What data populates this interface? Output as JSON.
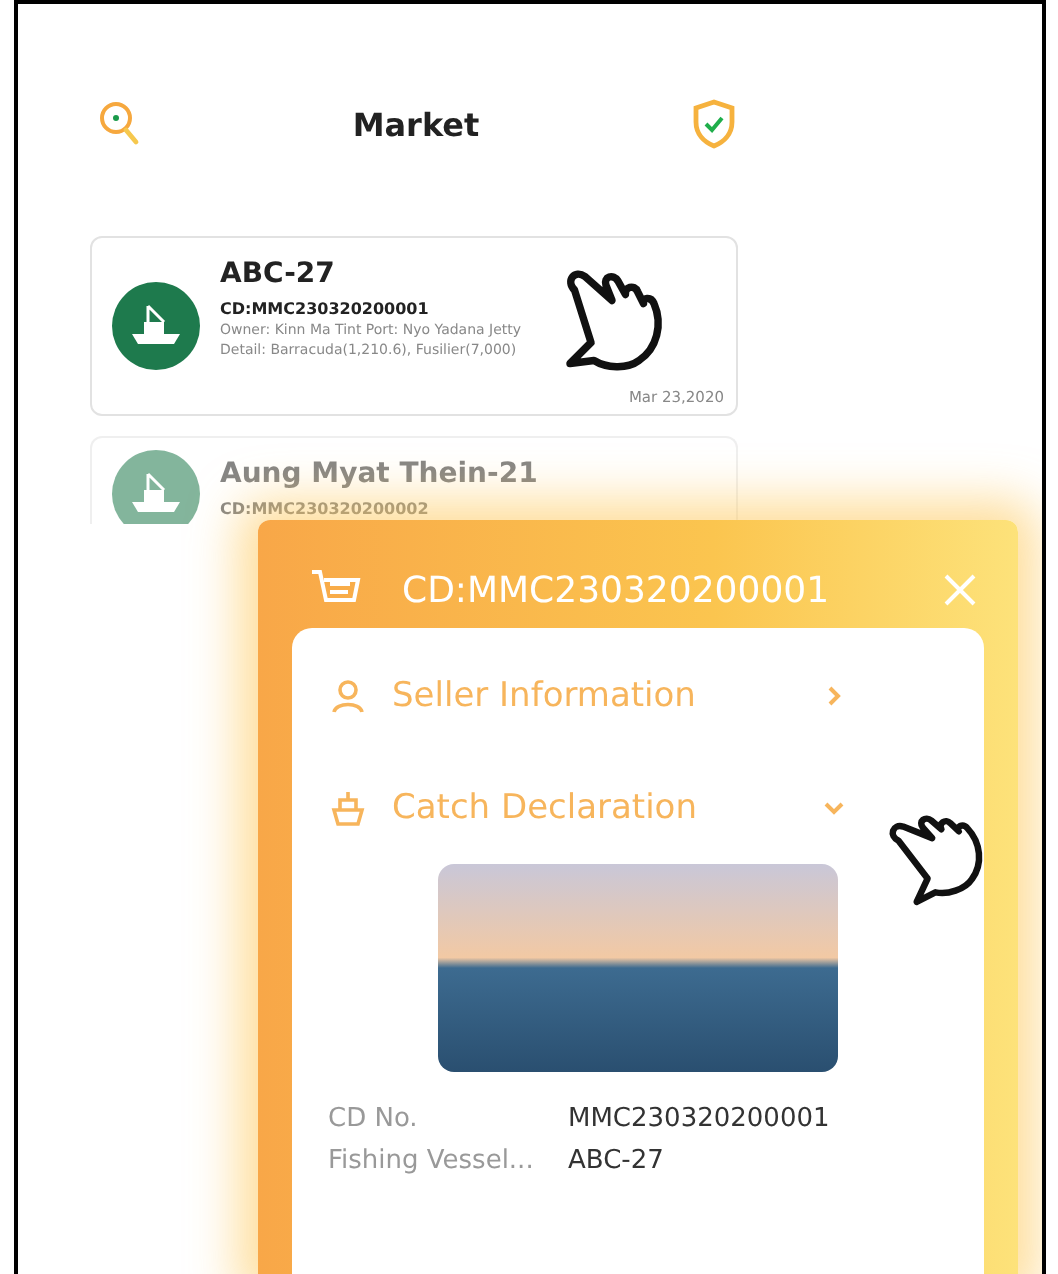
{
  "header": {
    "title": "Market"
  },
  "cards": [
    {
      "name": "ABC-27",
      "cd": "CD:MMC230320200001",
      "owner": "Owner: Kinn Ma Tint  Port: Nyo Yadana Jetty",
      "detail": "Detail: Barracuda(1,210.6), Fusilier(7,000)",
      "date": "Mar 23,2020",
      "faded": false
    },
    {
      "name": "Aung Myat Thein-21",
      "cd": "CD:MMC230320200002",
      "faded": true
    }
  ],
  "popup": {
    "title": "CD:MMC230320200001",
    "sections": [
      {
        "kind": "person",
        "label": "Seller Information",
        "expanded": false
      },
      {
        "kind": "ship",
        "label": "Catch Declaration",
        "expanded": true
      }
    ],
    "fields": [
      {
        "label": "CD No.",
        "value": "MMC230320200001"
      },
      {
        "label": "Fishing Vessel...",
        "value": "ABC-27"
      }
    ]
  }
}
